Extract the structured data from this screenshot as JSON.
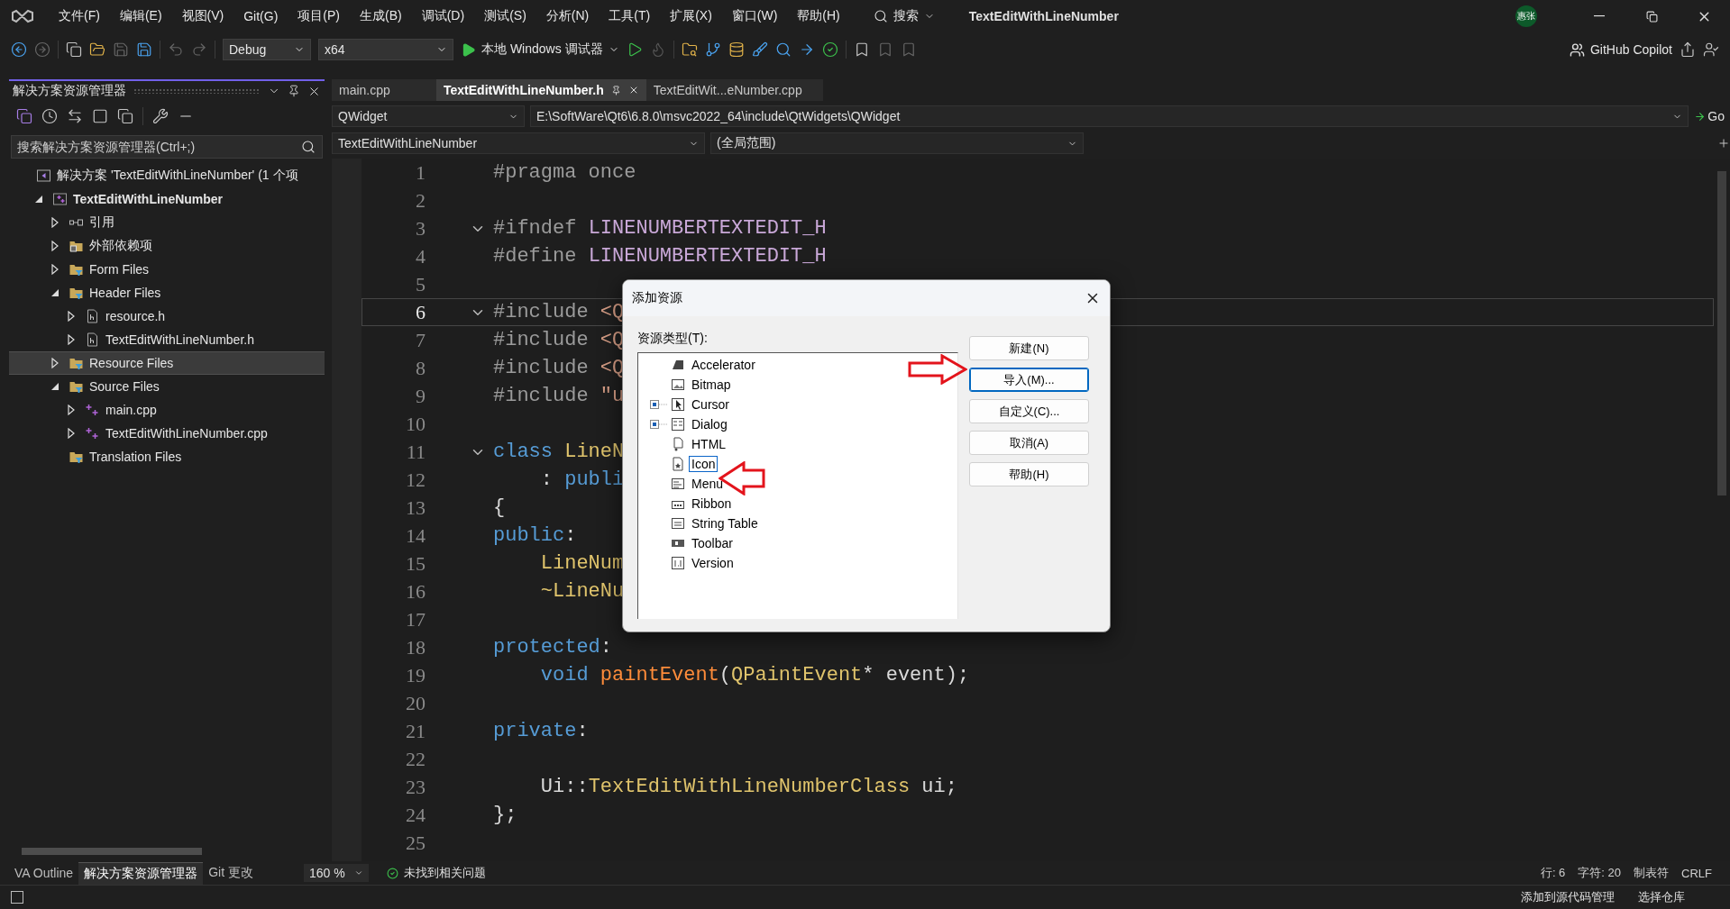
{
  "title_bar": {
    "menus": [
      "文件(F)",
      "编辑(E)",
      "视图(V)",
      "Git(G)",
      "项目(P)",
      "生成(B)",
      "调试(D)",
      "测试(S)",
      "分析(N)",
      "工具(T)",
      "扩展(X)",
      "窗口(W)",
      "帮助(H)"
    ],
    "search": "搜索",
    "title": "TextEditWithLineNumber",
    "avatar": "惠张"
  },
  "toolbar": {
    "configuration": "Debug",
    "platform": "x64",
    "run": "本地 Windows 调试器",
    "copilot": "GitHub Copilot"
  },
  "solution_explorer": {
    "title": "解决方案资源管理器",
    "search": {
      "placeholder": "搜索解决方案资源管理器(Ctrl+;)"
    },
    "tree": [
      {
        "label": "解决方案 'TextEditWithLineNumber' (1 个项",
        "kind": "solution",
        "selected": false,
        "children": [
          {
            "label": "TextEditWithLineNumber",
            "kind": "project",
            "expanded": true,
            "selected": false,
            "children": [
              {
                "label": "引用",
                "kind": "references",
                "expanded": false,
                "selected": false
              },
              {
                "label": "外部依赖项",
                "kind": "external",
                "expanded": false,
                "selected": false
              },
              {
                "label": "Form Files",
                "kind": "filter",
                "expanded": false,
                "selected": false
              },
              {
                "label": "Header Files",
                "kind": "filter",
                "expanded": true,
                "selected": false,
                "children": [
                  {
                    "label": "resource.h",
                    "kind": "header",
                    "expanded": false,
                    "selected": false
                  },
                  {
                    "label": "TextEditWithLineNumber.h",
                    "kind": "header",
                    "expanded": false,
                    "selected": false
                  }
                ]
              },
              {
                "label": "Resource Files",
                "kind": "filter",
                "expanded": false,
                "selected": true
              },
              {
                "label": "Source Files",
                "kind": "filter",
                "expanded": true,
                "selected": false,
                "children": [
                  {
                    "label": "main.cpp",
                    "kind": "cpp",
                    "expanded": false,
                    "selected": false
                  },
                  {
                    "label": "TextEditWithLineNumber.cpp",
                    "kind": "cpp",
                    "expanded": false,
                    "selected": false
                  }
                ]
              },
              {
                "label": "Translation Files",
                "kind": "filter",
                "selected": false
              }
            ]
          }
        ]
      }
    ],
    "bottom_tabs": [
      {
        "label": "VA Outline",
        "selected": false
      },
      {
        "label": "解决方案资源管理器",
        "selected": true
      },
      {
        "label": "Git 更改",
        "selected": false
      }
    ]
  },
  "editor": {
    "tabs": [
      {
        "label": "main.cpp",
        "selected": false
      },
      {
        "label": "TextEditWithLineNumber.h",
        "selected": true
      },
      {
        "label": "TextEditWit...eNumber.cpp",
        "selected": false
      }
    ],
    "nav": {
      "class": "QWidget",
      "path": "E:\\SoftWare\\Qt6\\6.8.0\\msvc2022_64\\include\\QtWidgets\\QWidget",
      "go": "Go",
      "project": "TextEditWithLineNumber",
      "scope": "(全局范围)"
    },
    "lines": [
      {
        "number": "1",
        "fold": false,
        "current": false,
        "tokens": [
          {
            "text": "#pragma once",
            "kind": "preproc"
          }
        ]
      },
      {
        "number": "2",
        "fold": false,
        "current": false
      },
      {
        "number": "3",
        "fold": true,
        "current": false,
        "tokens": [
          {
            "text": "#ifndef ",
            "kind": "preproc"
          },
          {
            "text": "LINENUMBERTEXTEDIT_H",
            "kind": "macro"
          }
        ]
      },
      {
        "number": "4",
        "fold": false,
        "current": false,
        "tokens": [
          {
            "text": "#define ",
            "kind": "preproc"
          },
          {
            "text": "LINENUMBERTEXTEDIT_H",
            "kind": "macro"
          }
        ]
      },
      {
        "number": "5",
        "fold": false,
        "current": false
      },
      {
        "number": "6",
        "fold": true,
        "current": true,
        "tokens": [
          {
            "text": "#include ",
            "kind": "preproc"
          },
          {
            "text": "<Q",
            "kind": "string"
          }
        ]
      },
      {
        "number": "7",
        "fold": false,
        "current": false,
        "tokens": [
          {
            "text": "#include ",
            "kind": "preproc"
          },
          {
            "text": "<Q",
            "kind": "string"
          }
        ]
      },
      {
        "number": "8",
        "fold": false,
        "current": false,
        "tokens": [
          {
            "text": "#include ",
            "kind": "preproc"
          },
          {
            "text": "<Q",
            "kind": "string"
          }
        ]
      },
      {
        "number": "9",
        "fold": false,
        "current": false,
        "tokens": [
          {
            "text": "#include ",
            "kind": "preproc"
          },
          {
            "text": "\"u",
            "kind": "string"
          }
        ]
      },
      {
        "number": "10",
        "fold": false,
        "current": false
      },
      {
        "number": "11",
        "fold": true,
        "current": false,
        "tokens": [
          {
            "text": "class ",
            "kind": "keyword"
          },
          {
            "text": "LineN",
            "kind": "type"
          }
        ]
      },
      {
        "number": "12",
        "fold": false,
        "current": false,
        "tokens": [
          {
            "text": "    : ",
            "kind": "plain"
          },
          {
            "text": "publi",
            "kind": "keyword"
          }
        ]
      },
      {
        "number": "13",
        "fold": false,
        "current": false,
        "tokens": [
          {
            "text": "{",
            "kind": "plain"
          }
        ]
      },
      {
        "number": "14",
        "fold": false,
        "current": false,
        "tokens": [
          {
            "text": "public",
            "kind": "keyword"
          },
          {
            "text": ":",
            "kind": "plain"
          }
        ]
      },
      {
        "number": "15",
        "fold": false,
        "current": false,
        "tokens": [
          {
            "text": "    LineNum",
            "kind": "type"
          }
        ]
      },
      {
        "number": "16",
        "fold": false,
        "current": false,
        "tokens": [
          {
            "text": "    ~LineNu",
            "kind": "type"
          }
        ]
      },
      {
        "number": "17",
        "fold": false,
        "current": false
      },
      {
        "number": "18",
        "fold": false,
        "current": false,
        "tokens": [
          {
            "text": "protected",
            "kind": "keyword"
          },
          {
            "text": ":",
            "kind": "plain"
          }
        ]
      },
      {
        "number": "19",
        "fold": false,
        "current": false,
        "tokens": [
          {
            "text": "    void ",
            "kind": "keyword"
          },
          {
            "text": "paintEvent",
            "kind": "func"
          },
          {
            "text": "(",
            "kind": "plain"
          },
          {
            "text": "QPaintEvent",
            "kind": "type"
          },
          {
            "text": "* event);",
            "kind": "plain"
          }
        ]
      },
      {
        "number": "20",
        "fold": false,
        "current": false
      },
      {
        "number": "21",
        "fold": false,
        "current": false,
        "tokens": [
          {
            "text": "private",
            "kind": "keyword"
          },
          {
            "text": ":",
            "kind": "plain"
          }
        ]
      },
      {
        "number": "22",
        "fold": false,
        "current": false
      },
      {
        "number": "23",
        "fold": false,
        "current": false,
        "tokens": [
          {
            "text": "    Ui::",
            "kind": "plain"
          },
          {
            "text": "TextEditWithLineNumberClass",
            "kind": "type"
          },
          {
            "text": " ui;",
            "kind": "plain"
          }
        ]
      },
      {
        "number": "24",
        "fold": false,
        "current": false,
        "tokens": [
          {
            "text": "};",
            "kind": "plain"
          }
        ]
      },
      {
        "number": "25",
        "fold": false,
        "current": false
      }
    ]
  },
  "status_bar": {
    "zoom": "160 %",
    "issues": "未找到相关问题",
    "line": "行: 6",
    "char": "字符: 20",
    "tabs": "制表符",
    "eol": "CRLF"
  },
  "bottom_bar": {
    "source_control": "添加到源代码管理",
    "repository": "选择仓库"
  },
  "dialog": {
    "title": "添加资源",
    "list_label": "资源类型(T):",
    "items": [
      {
        "label": "Accelerator",
        "expandable": false,
        "selected": false
      },
      {
        "label": "Bitmap",
        "expandable": false,
        "selected": false
      },
      {
        "label": "Cursor",
        "expandable": true,
        "selected": false
      },
      {
        "label": "Dialog",
        "expandable": true,
        "selected": false
      },
      {
        "label": "HTML",
        "expandable": false,
        "selected": false
      },
      {
        "label": "Icon",
        "expandable": false,
        "selected": true
      },
      {
        "label": "Menu",
        "expandable": false,
        "selected": false
      },
      {
        "label": "Ribbon",
        "expandable": false,
        "selected": false
      },
      {
        "label": "String Table",
        "expandable": false,
        "selected": false
      },
      {
        "label": "Toolbar",
        "expandable": false,
        "selected": false
      },
      {
        "label": "Version",
        "expandable": false,
        "selected": false
      }
    ],
    "buttons": [
      {
        "label": "新建(N)",
        "focused": false
      },
      {
        "label": "导入(M)...",
        "focused": true
      },
      {
        "label": "自定义(C)...",
        "focused": false
      },
      {
        "label": "取消(A)",
        "focused": false
      },
      {
        "label": "帮助(H)",
        "focused": false
      }
    ]
  }
}
